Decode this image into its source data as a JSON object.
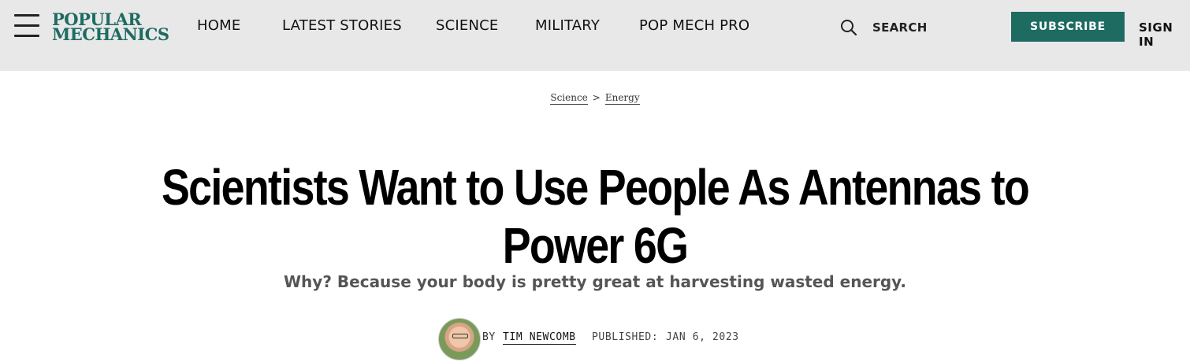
{
  "header": {
    "logo_line1": "POPULAR",
    "logo_line2": "MECHANICS",
    "nav": [
      "HOME",
      "LATEST STORIES",
      "SCIENCE",
      "MILITARY",
      "POP MECH PRO"
    ],
    "search_label": "SEARCH",
    "subscribe_label": "SUBSCRIBE",
    "signin_label": "SIGN IN",
    "brand_color": "#1e6b62"
  },
  "breadcrumb": {
    "section": "Science",
    "separator": ">",
    "subsection": "Energy"
  },
  "article": {
    "title": "Scientists Want to Use People As Antennas to Power 6G",
    "dek": "Why? Because your body is pretty great at harvesting wasted energy.",
    "byline_prefix": "BY",
    "author": "TIM NEWCOMB",
    "published_label": "PUBLISHED:",
    "published_date": "JAN 6, 2023"
  }
}
